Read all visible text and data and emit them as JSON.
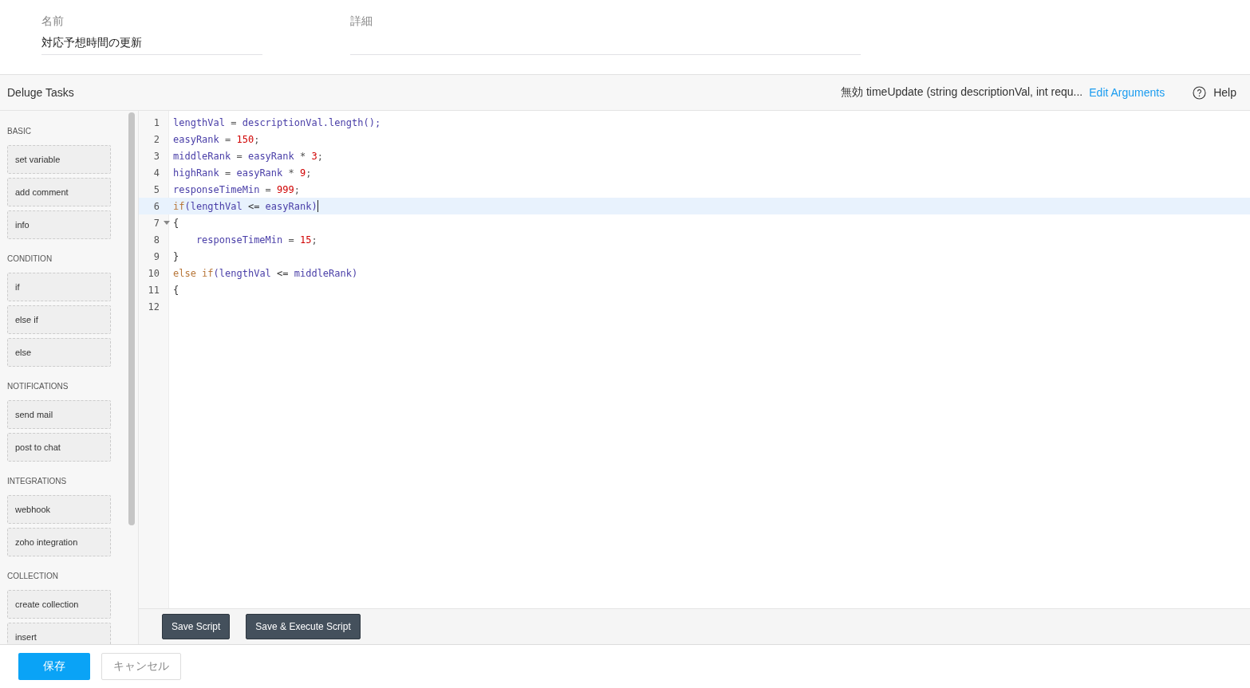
{
  "form": {
    "fields": [
      {
        "label": "名前",
        "value": "対応予想時間の更新"
      },
      {
        "label": "詳細"
      }
    ]
  },
  "toolbar": {
    "title": "Deluge Tasks",
    "signature": "無効 timeUpdate (string descriptionVal, int requ...",
    "edit_link": "Edit Arguments",
    "help": "Help"
  },
  "sidebar": {
    "sections": [
      {
        "heading": "BASIC",
        "items": [
          "set variable",
          "add comment",
          "info"
        ]
      },
      {
        "heading": "CONDITION",
        "items": [
          "if",
          "else if",
          "else"
        ]
      },
      {
        "heading": "NOTIFICATIONS",
        "items": [
          "send mail",
          "post to chat"
        ]
      },
      {
        "heading": "INTEGRATIONS",
        "items": [
          "webhook",
          "zoho integration"
        ]
      },
      {
        "heading": "COLLECTION",
        "items": [
          "create collection",
          "insert"
        ]
      }
    ]
  },
  "editor": {
    "lines": [
      {
        "number": "1",
        "active": false,
        "foldable": false,
        "tokens": [
          {
            "t": "lengthVal",
            "kind": "variable"
          },
          {
            "t": " = ",
            "kind": "operator"
          },
          {
            "t": "descriptionVal.length();",
            "kind": "variable"
          }
        ]
      },
      {
        "number": "2",
        "active": false,
        "foldable": false,
        "tokens": [
          {
            "t": "easyRank",
            "kind": "variable"
          },
          {
            "t": " = ",
            "kind": "operator"
          },
          {
            "t": "150",
            "kind": "number"
          },
          {
            "t": ";",
            "kind": "operator"
          }
        ]
      },
      {
        "number": "3",
        "active": false,
        "foldable": false,
        "tokens": [
          {
            "t": "middleRank",
            "kind": "variable"
          },
          {
            "t": " = ",
            "kind": "operator"
          },
          {
            "t": "easyRank",
            "kind": "variable"
          },
          {
            "t": " * ",
            "kind": "operator"
          },
          {
            "t": "3",
            "kind": "number"
          },
          {
            "t": ";",
            "kind": "operator"
          }
        ]
      },
      {
        "number": "4",
        "active": false,
        "foldable": false,
        "tokens": [
          {
            "t": "highRank",
            "kind": "variable"
          },
          {
            "t": " = ",
            "kind": "operator"
          },
          {
            "t": "easyRank",
            "kind": "variable"
          },
          {
            "t": " * ",
            "kind": "operator"
          },
          {
            "t": "9",
            "kind": "number"
          },
          {
            "t": ";",
            "kind": "operator"
          }
        ]
      },
      {
        "number": "5",
        "active": false,
        "foldable": false,
        "tokens": [
          {
            "t": "responseTimeMin",
            "kind": "variable"
          },
          {
            "t": " = ",
            "kind": "operator"
          },
          {
            "t": "999",
            "kind": "number"
          },
          {
            "t": ";",
            "kind": "operator"
          }
        ]
      },
      {
        "number": "6",
        "active": true,
        "foldable": false,
        "tokens": [
          {
            "t": "if",
            "kind": "keyword"
          },
          {
            "t": "(lengthVal ",
            "kind": "variable"
          },
          {
            "t": "<=",
            "kind": "punctuation"
          },
          {
            "t": " easyRank)",
            "kind": "variable"
          }
        ]
      },
      {
        "number": "7",
        "active": false,
        "foldable": true,
        "tokens": [
          {
            "t": "{",
            "kind": "punctuation"
          }
        ]
      },
      {
        "number": "8",
        "active": false,
        "foldable": false,
        "tokens": [
          {
            "t": "    responseTimeMin",
            "kind": "variable"
          },
          {
            "t": " = ",
            "kind": "operator"
          },
          {
            "t": "15",
            "kind": "number"
          },
          {
            "t": ";",
            "kind": "operator"
          }
        ]
      },
      {
        "number": "9",
        "active": false,
        "foldable": false,
        "tokens": [
          {
            "t": "}",
            "kind": "punctuation"
          }
        ]
      },
      {
        "number": "10",
        "active": false,
        "foldable": false,
        "tokens": [
          {
            "t": "else if",
            "kind": "keyword"
          },
          {
            "t": "(lengthVal ",
            "kind": "variable"
          },
          {
            "t": "<=",
            "kind": "punctuation"
          },
          {
            "t": " middleRank)",
            "kind": "variable"
          }
        ]
      },
      {
        "number": "11",
        "active": false,
        "foldable": false,
        "tokens": [
          {
            "t": "{",
            "kind": "punctuation"
          }
        ]
      },
      {
        "number": "12",
        "active": false,
        "foldable": false
      }
    ],
    "buttons": [
      "Save Script",
      "Save & Execute Script"
    ]
  },
  "footer": {
    "save": "保存",
    "cancel": "キャンセル"
  }
}
